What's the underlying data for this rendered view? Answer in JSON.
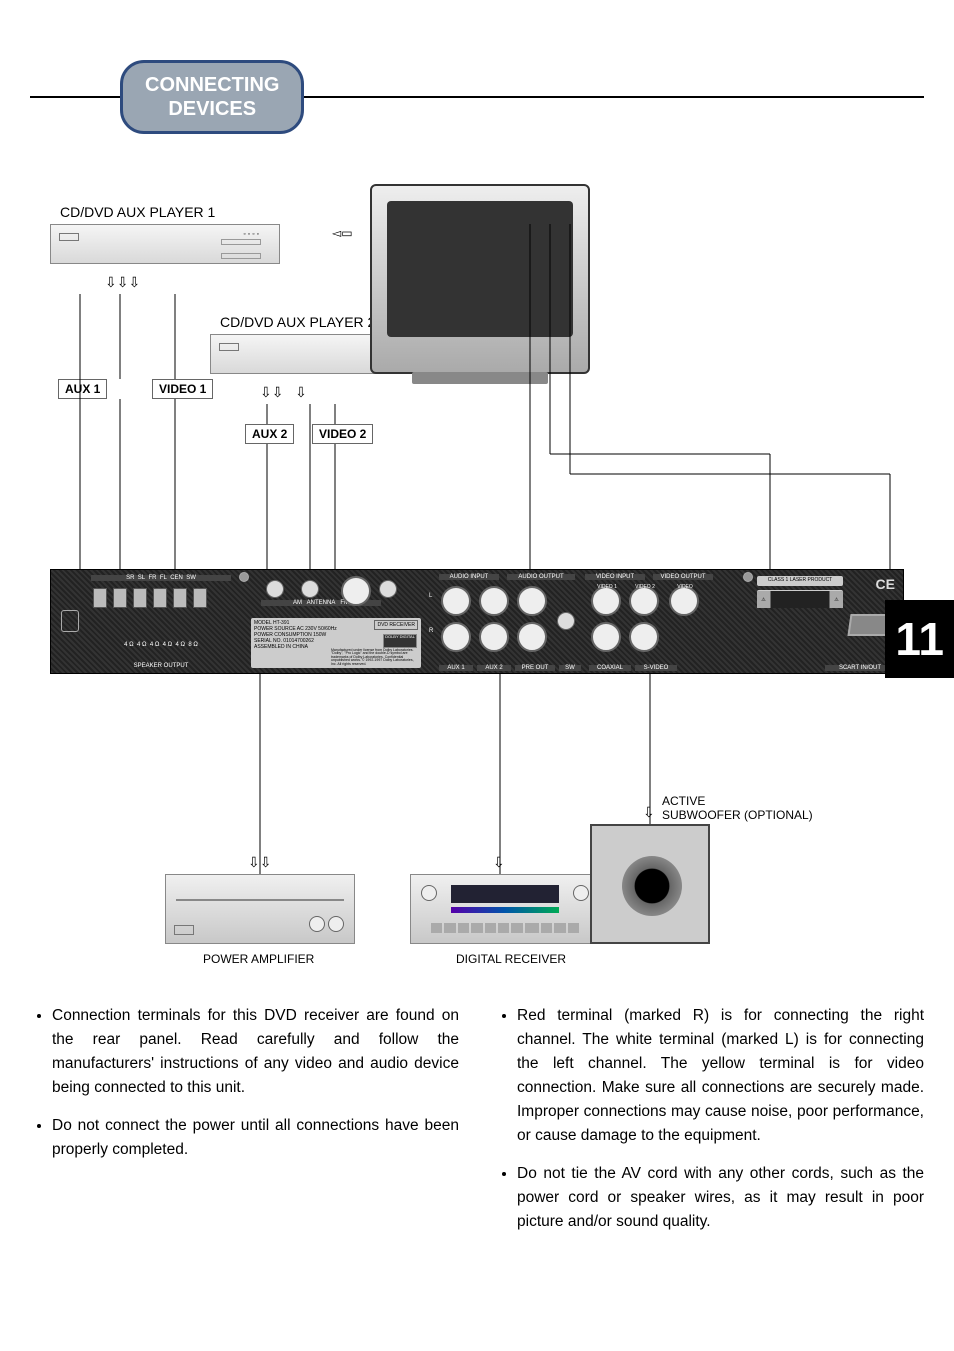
{
  "header": {
    "badge_line1": "CONNECTING",
    "badge_line2": "DEVICES"
  },
  "page_number": "11",
  "diagram": {
    "device_labels": {
      "aux_player_1": "CD/DVD AUX PLAYER 1",
      "aux_player_2": "CD/DVD AUX PLAYER 2",
      "power_amplifier": "POWER AMPLIFIER",
      "digital_receiver": "DIGITAL RECEIVER",
      "active_subwoofer": "ACTIVE\nSUBWOOFER (OPTIONAL)"
    },
    "jack_labels": {
      "aux1": "AUX 1",
      "video1": "VIDEO 1",
      "aux2": "AUX 2",
      "video2": "VIDEO 2"
    },
    "rear_panel": {
      "model_line": "MODEL HT-391",
      "category": "DVD RECEIVER",
      "power_source": "POWER SOURCE    AC 230V 50/60Hz",
      "power_consumption": "POWER CONSUMPTION      150W",
      "serial_no": "SERIAL NO.      01014700262",
      "assembled_in": "ASSEMBLED IN CHINA",
      "speaker_section_header": "SPEAKER OUTPUT",
      "speaker_terminals": [
        "SR",
        "SL",
        "FR",
        "FL",
        "CEN",
        "SW"
      ],
      "impedance_row": [
        "4 Ω",
        "4 Ω",
        "4 Ω",
        "4 Ω",
        "4 Ω",
        "8 Ω"
      ],
      "antenna_block": {
        "am": "AM",
        "header": "ANTENNA",
        "fm": "FM"
      },
      "audio_input_header": "AUDIO INPUT",
      "audio_output_header": "AUDIO OUTPUT",
      "video_input_header": "VIDEO INPUT",
      "video_output_header": "VIDEO OUTPUT",
      "bottom_jack_labels": [
        "AUX 1",
        "AUX 2",
        "PRE OUT",
        "SW",
        "COAXIAL",
        "S-VIDEO"
      ],
      "video_in_labels": [
        "VIDEO 1",
        "VIDEO 2"
      ],
      "video_out_label": "VIDEO",
      "lr_markers": [
        "L",
        "R"
      ],
      "scart_label": "SCART IN/OUT",
      "laser_warning": "CLASS 1 LASER PRODUCT",
      "dolby": "DOLBY DIGITAL",
      "legal_text": "Manufactured under license from Dolby Laboratories. \"Dolby\", \"Pro Logic\" and the double-D symbol are trademarks of Dolby Laboratories. Confidential unpublished works. © 1992-1997 Dolby Laboratories, Inc. All rights reserved."
    }
  },
  "text_columns": {
    "left": [
      "Connection terminals for this DVD receiver are found on the rear panel.  Read carefully and follow the manufacturers' instructions of any video and audio device being connected to this unit.",
      "Do not connect the power until all connections have been properly completed."
    ],
    "right": [
      "Red terminal (marked R) is for connecting the right channel. The white terminal (marked L) is for connecting the left channel.  The yellow terminal is for video connection.  Make sure all connections are securely made. Improper connections may cause noise, poor performance, or cause damage to the equipment.",
      "Do not tie the AV cord with any other cords, such as the power cord or speaker wires, as it may result in poor picture and/or sound quality."
    ]
  }
}
